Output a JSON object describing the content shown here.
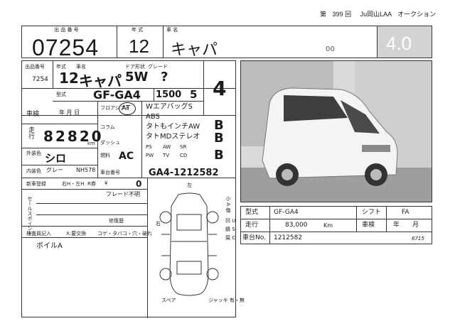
{
  "header": {
    "session": "第",
    "session_no": "399",
    "session_unit": "回",
    "auction": "Ju岡山LAA",
    "suffix": "オークション"
  },
  "top_row": {
    "lot_label": "出 品 番 号",
    "lot_number": "07254",
    "year_label": "年 式",
    "year": "12",
    "model_label": "車 名",
    "model": "キャパ",
    "model_extra": "00",
    "grade": "4.0"
  },
  "form": {
    "small_lot_label": "出品番号",
    "small_lot": "7254",
    "year_label": "年式",
    "model_label": "車名",
    "door_label": "ドア形状",
    "grade_label": "グレード",
    "year_hw": "12",
    "model_hw": "キャパ",
    "door_hw": "5W",
    "grade_hw": "?",
    "score_hw": "4",
    "type_label": "型式",
    "type_hw": "GF-GA4",
    "cc_hw": "1500",
    "seats_hw": "5",
    "shaken_label": "車検",
    "shaken_ym": "年 月 日",
    "mileage_label": "走行",
    "mileage_hw": "82820",
    "km": "km",
    "color_label": "外装色",
    "color_hw": "シロ",
    "interior_label": "内装色",
    "interior_hw": "グレー",
    "colorcode_hw": "NH578",
    "fuel_label": "燃料",
    "aircon_hw": "AC",
    "new_reg_label": "新車登録",
    "drive_label": "右H・左H",
    "r_label": "R券",
    "yen_label": "¥",
    "recycle_hw": "0",
    "col2_items": [
      "フロアシフト",
      "コラム",
      "ダッシュ"
    ],
    "col2_at": "AT",
    "equip_lines": [
      "WエアバッグS",
      "ABS",
      "タトもインチAW",
      "タトMDステレオ"
    ],
    "score_marks": [
      "B",
      "B",
      "B"
    ],
    "equip_codes": [
      "PS",
      "AW",
      "SR",
      "PW",
      "TV",
      "CD"
    ],
    "chassis_label": "車台番号",
    "chassis_hw": "GA4-1212582",
    "sales_point_label": "セールスポイント",
    "note_hw": "フレード不明",
    "repair_label": "修復歴",
    "inspector_label": "検査員記入",
    "inspector_items": [
      "X:要交換",
      "コゲ・タバコ・穴・破れ"
    ],
    "inspector_note_hw": "ボイルA",
    "diagram_front": "左",
    "diagram_right": "右",
    "diagram_labels": [
      "小 A 傷",
      "凹 U",
      "錆 S",
      "腐 C",
      "ジャッキ 有・無",
      "スペア"
    ]
  },
  "info_table": {
    "rows": [
      {
        "label": "型式",
        "value": "GF-GA4",
        "label2": "シフト",
        "value2": "FA"
      },
      {
        "label": "走行",
        "value": "83,000",
        "unit": "Km",
        "label2": "車検",
        "value2": "年　　月"
      },
      {
        "label": "車台No.",
        "value": "1212582",
        "label2": "",
        "value2": ""
      }
    ],
    "stamp": "6715"
  }
}
